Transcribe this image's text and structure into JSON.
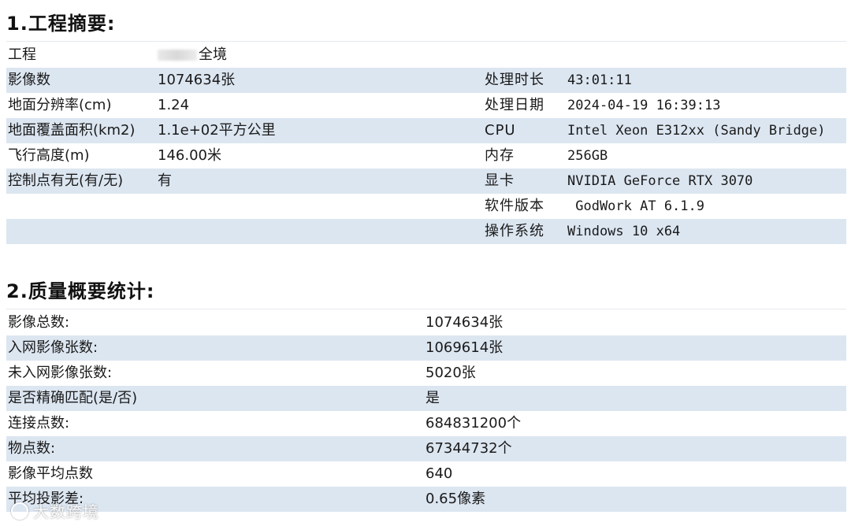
{
  "section1": {
    "title": "1.工程摘要:",
    "rows": [
      {
        "label": "工程",
        "value": "全境",
        "label2": "",
        "value2": ""
      },
      {
        "label": "影像数",
        "value": "1074634张",
        "label2": "处理时长",
        "value2": "43:01:11"
      },
      {
        "label": "地面分辨率(cm)",
        "value": "1.24",
        "label2": "处理日期",
        "value2": "2024-04-19 16:39:13"
      },
      {
        "label": "地面覆盖面积(km2)",
        "value": "1.1e+02平方公里",
        "label2": "CPU",
        "value2": "Intel Xeon E312xx (Sandy Bridge)"
      },
      {
        "label": "飞行高度(m)",
        "value": "146.00米",
        "label2": "内存",
        "value2": "256GB"
      },
      {
        "label": "控制点有无(有/无)",
        "value": "有",
        "label2": "显卡",
        "value2": "NVIDIA GeForce RTX 3070"
      },
      {
        "label": "",
        "value": "",
        "label2": "软件版本",
        "value2": " GodWork AT 6.1.9"
      },
      {
        "label": "",
        "value": "",
        "label2": "操作系统",
        "value2": "Windows 10 x64"
      }
    ]
  },
  "section2": {
    "title": "2.质量概要统计:",
    "rows": [
      {
        "label": "影像总数:",
        "value": "1074634张"
      },
      {
        "label": "入网影像张数:",
        "value": "1069614张"
      },
      {
        "label": "未入网影像张数:",
        "value": "5020张"
      },
      {
        "label": "是否精确匹配(是/否)",
        "value": "是"
      },
      {
        "label": "连接点数:",
        "value": "684831200个"
      },
      {
        "label": "物点数:",
        "value": "67344732个"
      },
      {
        "label": "影像平均点数",
        "value": "640"
      },
      {
        "label": "平均投影差:",
        "value": "0.65像素"
      }
    ]
  },
  "watermark": {
    "text": "大数跨境"
  },
  "colors": {
    "stripe": "#dce6f1",
    "text": "#1a1a1a"
  }
}
